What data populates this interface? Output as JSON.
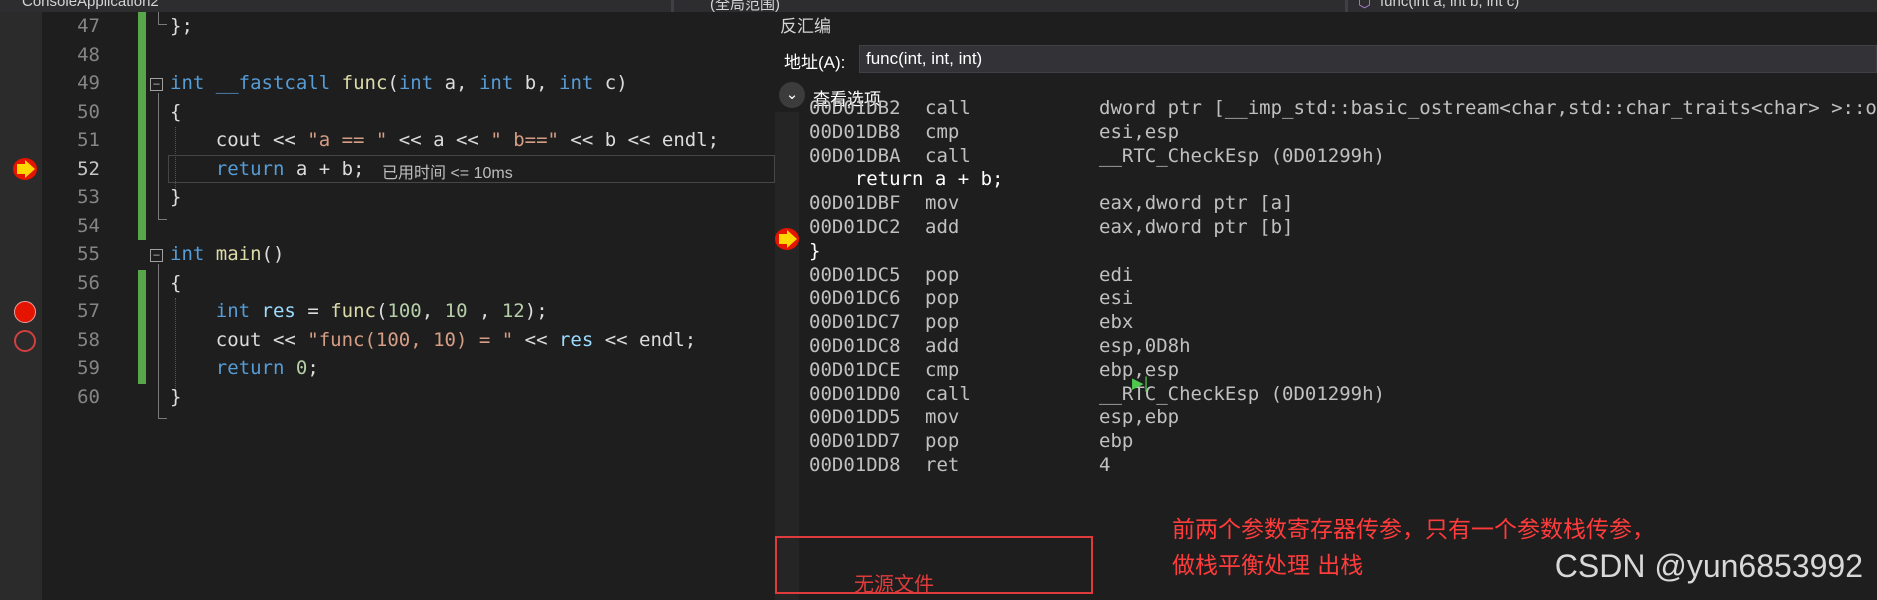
{
  "tabs": {
    "project": "ConsoleApplication2",
    "scope": "(全局范围)",
    "function": "func(int a, int b, int c)"
  },
  "editor": {
    "lines": [
      {
        "num": "47",
        "tokens": [
          {
            "t": "};",
            "c": "plain"
          }
        ]
      },
      {
        "num": "48",
        "tokens": []
      },
      {
        "num": "49",
        "tokens": [
          {
            "t": "int",
            "c": "kw"
          },
          {
            "t": " ",
            "c": "plain"
          },
          {
            "t": "__fastcall",
            "c": "kw"
          },
          {
            "t": " ",
            "c": "plain"
          },
          {
            "t": "func",
            "c": "fn"
          },
          {
            "t": "(",
            "c": "plain"
          },
          {
            "t": "int",
            "c": "kw"
          },
          {
            "t": " a, ",
            "c": "plain"
          },
          {
            "t": "int",
            "c": "kw"
          },
          {
            "t": " b, ",
            "c": "plain"
          },
          {
            "t": "int",
            "c": "kw"
          },
          {
            "t": " c)",
            "c": "plain"
          }
        ]
      },
      {
        "num": "50",
        "tokens": [
          {
            "t": "{",
            "c": "plain"
          }
        ]
      },
      {
        "num": "51",
        "tokens": [
          {
            "t": "    cout << ",
            "c": "plain"
          },
          {
            "t": "\"a == \"",
            "c": "str"
          },
          {
            "t": " << a << ",
            "c": "plain"
          },
          {
            "t": "\" b==\"",
            "c": "str"
          },
          {
            "t": " << b << endl;",
            "c": "plain"
          }
        ]
      },
      {
        "num": "52",
        "tokens": [
          {
            "t": "    ",
            "c": "plain"
          },
          {
            "t": "return",
            "c": "kw"
          },
          {
            "t": " a + b;",
            "c": "plain"
          }
        ]
      },
      {
        "num": "53",
        "tokens": [
          {
            "t": "}",
            "c": "plain"
          }
        ]
      },
      {
        "num": "54",
        "tokens": []
      },
      {
        "num": "55",
        "tokens": [
          {
            "t": "int",
            "c": "kw"
          },
          {
            "t": " ",
            "c": "plain"
          },
          {
            "t": "main",
            "c": "fn"
          },
          {
            "t": "()",
            "c": "plain"
          }
        ]
      },
      {
        "num": "56",
        "tokens": [
          {
            "t": "{",
            "c": "plain"
          }
        ]
      },
      {
        "num": "57",
        "tokens": [
          {
            "t": "    ",
            "c": "plain"
          },
          {
            "t": "int",
            "c": "kw"
          },
          {
            "t": " ",
            "c": "plain"
          },
          {
            "t": "res",
            "c": "var"
          },
          {
            "t": " = ",
            "c": "plain"
          },
          {
            "t": "func",
            "c": "fn"
          },
          {
            "t": "(",
            "c": "plain"
          },
          {
            "t": "100",
            "c": "num"
          },
          {
            "t": ", ",
            "c": "plain"
          },
          {
            "t": "10",
            "c": "num"
          },
          {
            "t": " , ",
            "c": "plain"
          },
          {
            "t": "12",
            "c": "num"
          },
          {
            "t": ");",
            "c": "plain"
          }
        ]
      },
      {
        "num": "58",
        "tokens": [
          {
            "t": "    cout << ",
            "c": "plain"
          },
          {
            "t": "\"func(100, 10) = \"",
            "c": "str"
          },
          {
            "t": " << ",
            "c": "plain"
          },
          {
            "t": "res",
            "c": "var"
          },
          {
            "t": " << endl;",
            "c": "plain"
          }
        ]
      },
      {
        "num": "59",
        "tokens": [
          {
            "t": "    ",
            "c": "plain"
          },
          {
            "t": "return",
            "c": "kw"
          },
          {
            "t": " ",
            "c": "plain"
          },
          {
            "t": "0",
            "c": "num"
          },
          {
            "t": ";",
            "c": "plain"
          }
        ]
      },
      {
        "num": "60",
        "tokens": [
          {
            "t": "}",
            "c": "plain"
          }
        ]
      }
    ],
    "current_line": "52",
    "elapsed_hint": "已用时间 <= 10ms"
  },
  "disassembly": {
    "title": "反汇编",
    "address_label": "地址(A):",
    "address_value": "func(int, int, int)",
    "view_options": "查看选项",
    "rows": [
      {
        "kind": "asm",
        "addr": "00D01DB2",
        "op": "call",
        "arg": "dword ptr [__imp_std::basic_ostream<char,std::char_traits<char> >::ope"
      },
      {
        "kind": "asm",
        "addr": "00D01DB8",
        "op": "cmp",
        "arg": "esi,esp"
      },
      {
        "kind": "asm",
        "addr": "00D01DBA",
        "op": "call",
        "arg": "__RTC_CheckEsp (0D01299h)"
      },
      {
        "kind": "src",
        "text": "    return a + b;"
      },
      {
        "kind": "asm",
        "addr": "00D01DBF",
        "op": "mov",
        "arg": "eax,dword ptr [a]",
        "current": true
      },
      {
        "kind": "asm",
        "addr": "00D01DC2",
        "op": "add",
        "arg": "eax,dword ptr [b]"
      },
      {
        "kind": "src",
        "text": "}"
      },
      {
        "kind": "asm",
        "addr": "00D01DC5",
        "op": "pop",
        "arg": "edi"
      },
      {
        "kind": "asm",
        "addr": "00D01DC6",
        "op": "pop",
        "arg": "esi"
      },
      {
        "kind": "asm",
        "addr": "00D01DC7",
        "op": "pop",
        "arg": "ebx"
      },
      {
        "kind": "asm",
        "addr": "00D01DC8",
        "op": "add",
        "arg": "esp,0D8h"
      },
      {
        "kind": "asm",
        "addr": "00D01DCE",
        "op": "cmp",
        "arg": "ebp,esp"
      },
      {
        "kind": "asm",
        "addr": "00D01DD0",
        "op": "call",
        "arg": "__RTC_CheckEsp (0D01299h)"
      },
      {
        "kind": "asm",
        "addr": "00D01DD5",
        "op": "mov",
        "arg": "esp,ebp"
      },
      {
        "kind": "asm",
        "addr": "00D01DD7",
        "op": "pop",
        "arg": "ebp"
      },
      {
        "kind": "asm",
        "addr": "00D01DD8",
        "op": "ret",
        "arg": "4"
      }
    ],
    "no_source": "无源文件",
    "run_to_cursor_glyph": "▶|"
  },
  "annotation": {
    "line1": "前两个参数寄存器传参，只有一个参数栈传参，",
    "line2": "做栈平衡处理 出栈"
  },
  "watermark": "CSDN @yun6853992",
  "colors": {
    "keyword": "#569cd6",
    "function": "#dcdcaa",
    "string": "#d69d85",
    "number": "#b5cea8",
    "annotation_red": "#e03b3b",
    "changed_green": "#57a64a"
  }
}
